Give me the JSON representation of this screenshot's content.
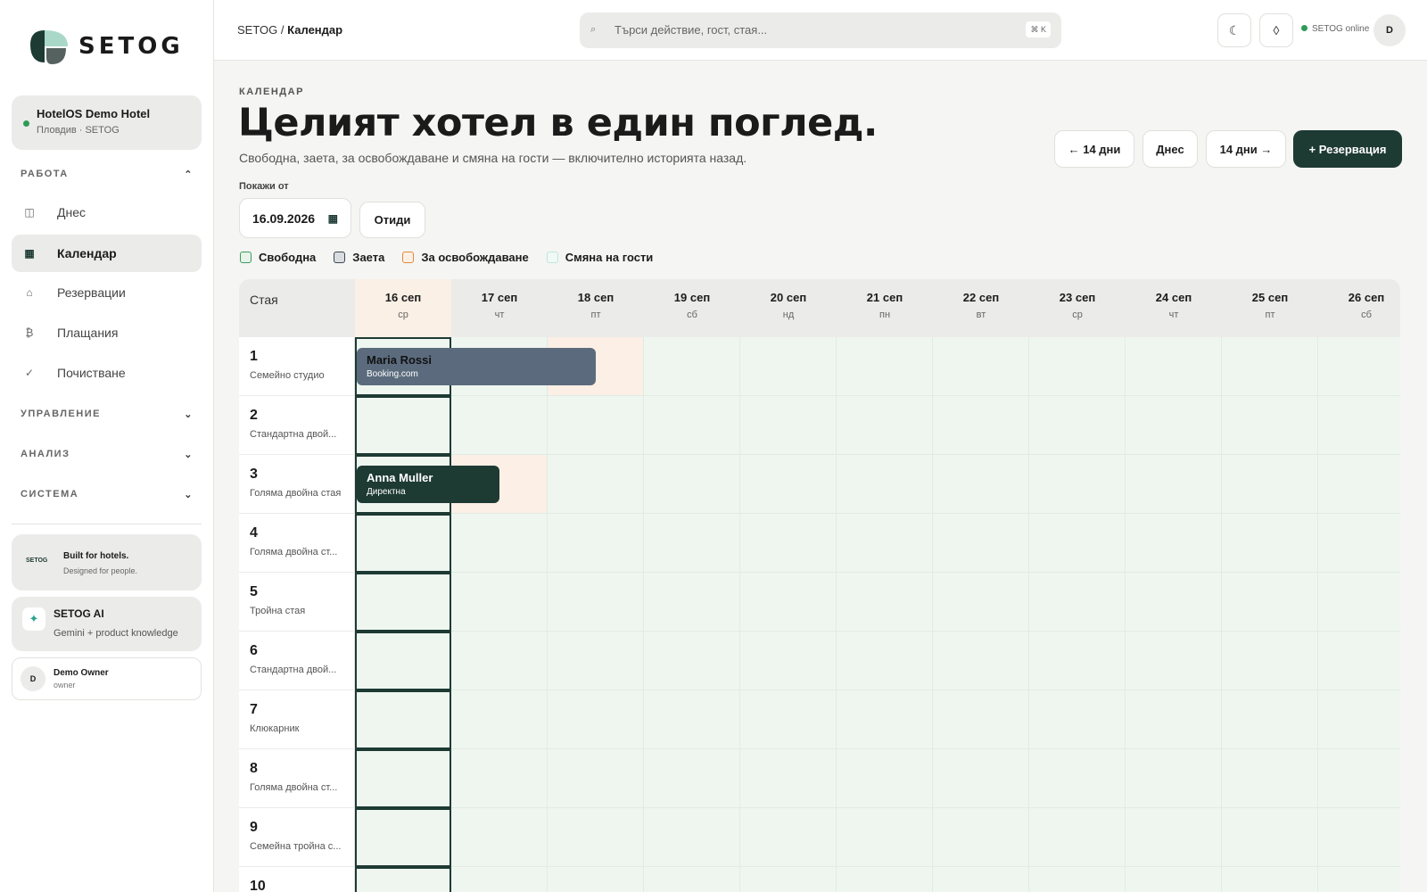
{
  "brand": {
    "name": "SETOG"
  },
  "hotel": {
    "name": "HotelOS Demo Hotel",
    "sub": "Пловдив · SETOG"
  },
  "sidebar": {
    "sections": [
      {
        "label": "РАБОТА",
        "chevron": "⌃"
      },
      {
        "label": "УПРАВЛЕНИЕ",
        "chevron": "⌄"
      },
      {
        "label": "АНАЛИЗ",
        "chevron": "⌄"
      },
      {
        "label": "СИСТЕМА",
        "chevron": "⌄"
      }
    ],
    "items": [
      {
        "label": "Днес",
        "icon": "◫",
        "icon_name": "today-icon"
      },
      {
        "label": "Календар",
        "icon": "▦",
        "icon_name": "calendar-icon"
      },
      {
        "label": "Резервации",
        "icon": "⌂",
        "icon_name": "home-icon"
      },
      {
        "label": "Плащания",
        "icon": "₿",
        "icon_name": "payment-icon"
      },
      {
        "label": "Почистване",
        "icon": "✓",
        "icon_name": "check-icon"
      }
    ],
    "promo": {
      "mini_logo": "SETOG",
      "title": "Built for hotels.",
      "subtitle": "Designed for people."
    },
    "ai": {
      "icon": "✦",
      "title": "SETOG AI",
      "subtitle": "Gemini + product knowledge"
    },
    "user": {
      "initial": "D",
      "name": "Demo Owner",
      "role": "owner"
    }
  },
  "topbar": {
    "breadcrumb_root": "SETOG",
    "breadcrumb_sep": "/",
    "breadcrumb_current": "Календар",
    "search_icon": "⌕",
    "search_placeholder": "Търси действие, гост, стая...",
    "search_shortcut": "⌘ K",
    "theme_icon": "☾",
    "diamond_icon": "◊",
    "status": "SETOG online",
    "avatar": "D"
  },
  "page": {
    "eyebrow": "КАЛЕНДАР",
    "title": "Целият хотел в един поглед.",
    "subtitle": "Свободна, заета, за освобождаване и смяна на гости — включително историята назад.",
    "buttons": {
      "prev": "← 14 дни",
      "today": "Днес",
      "next": "14 дни →",
      "new_booking": "+ Резервация"
    },
    "from_label": "Покажи от",
    "from_date": "16.09.2026",
    "calendar_icon": "▦",
    "go": "Отиди"
  },
  "legend": [
    {
      "label": "Свободна",
      "fill": "#e8f4ea",
      "border": "#3a9a5c"
    },
    {
      "label": "Заета",
      "fill": "#d9dde2",
      "border": "#3c4650"
    },
    {
      "label": "За освобождаване",
      "fill": "#fcefe5",
      "border": "#e08a3c"
    },
    {
      "label": "Смяна на гости",
      "fill": "#eff9f6",
      "border": "#bfe6dc"
    }
  ],
  "calendar": {
    "room_header": "Стая",
    "days": [
      {
        "date": "16 сеп",
        "dow": "ср"
      },
      {
        "date": "17 сеп",
        "dow": "чт"
      },
      {
        "date": "18 сеп",
        "dow": "пт"
      },
      {
        "date": "19 сеп",
        "dow": "сб"
      },
      {
        "date": "20 сеп",
        "dow": "нд"
      },
      {
        "date": "21 сеп",
        "dow": "пн"
      },
      {
        "date": "22 сеп",
        "dow": "вт"
      },
      {
        "date": "23 сеп",
        "dow": "ср"
      },
      {
        "date": "24 сеп",
        "dow": "чт"
      },
      {
        "date": "25 сеп",
        "dow": "пт"
      },
      {
        "date": "26 сеп",
        "dow": "сб"
      }
    ],
    "rooms": [
      {
        "number": "1",
        "type": "Семейно студио"
      },
      {
        "number": "2",
        "type": "Стандартна двой..."
      },
      {
        "number": "3",
        "type": "Голяма двойна стая"
      },
      {
        "number": "4",
        "type": "Голяма двойна ст..."
      },
      {
        "number": "5",
        "type": "Тройна стая"
      },
      {
        "number": "6",
        "type": "Стандартна двой..."
      },
      {
        "number": "7",
        "type": "Клюкарник"
      },
      {
        "number": "8",
        "type": "Голяма двойна ст..."
      },
      {
        "number": "9",
        "type": "Семейна тройна с..."
      },
      {
        "number": "10",
        "type": ""
      }
    ],
    "bookings": [
      {
        "room": "1",
        "guest": "Maria Rossi",
        "source": "Booking.com",
        "start_day": 0,
        "nights": 2,
        "checkout_day": 2,
        "style": "gray"
      },
      {
        "room": "3",
        "guest": "Anna Muller",
        "source": "Директна",
        "start_day": 0,
        "nights": 1,
        "checkout_day": 1,
        "style": "dark"
      }
    ]
  }
}
